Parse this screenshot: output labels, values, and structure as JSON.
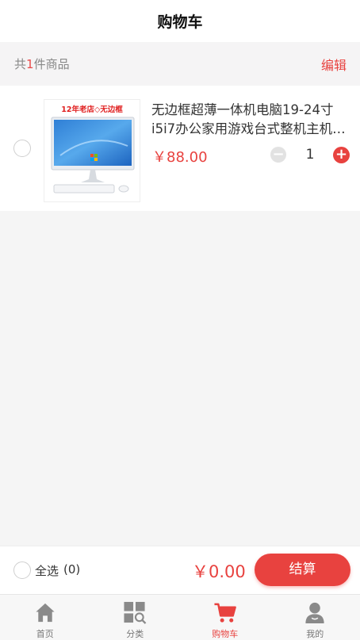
{
  "header": {
    "title": "购物车"
  },
  "summary": {
    "prefix": "共",
    "count": "1",
    "suffix": "件商品",
    "edit_label": "编辑"
  },
  "cart_items": [
    {
      "name_line1": "无边框超薄一体机电脑19-24寸",
      "name_line2": "i5i7办公家用游戏台式整机主机…",
      "price": "￥88.00",
      "quantity": "1",
      "image_banner": "12年老店◇无边框",
      "selected": false
    }
  ],
  "checkout": {
    "select_all_label": "全选",
    "selected_count": "(0)",
    "total": "￥0.00",
    "pay_label": "结算"
  },
  "tabbar": {
    "items": [
      {
        "label": "首页",
        "icon": "home-icon"
      },
      {
        "label": "分类",
        "icon": "category-icon"
      },
      {
        "label": "购物车",
        "icon": "cart-icon",
        "active": true
      },
      {
        "label": "我的",
        "icon": "user-icon"
      }
    ]
  },
  "colors": {
    "accent": "#e8423f",
    "inactive": "#888888"
  }
}
